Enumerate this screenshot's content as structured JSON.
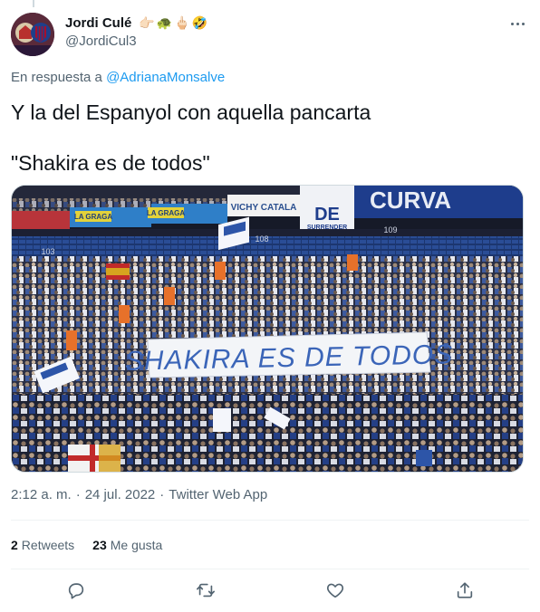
{
  "tweet": {
    "author": {
      "display_name": "Jordi Culé",
      "handle": "@JordiCul3",
      "name_emojis": [
        "👉🏻",
        "🐢",
        "🖕🏻",
        "🤣"
      ]
    },
    "reply_prefix": "En respuesta a",
    "reply_to": "@AdrianaMonsalve",
    "text_line1": "Y la del Espanyol con aquella pancarta",
    "text_line2": "\"Shakira es de todos\"",
    "photo": {
      "banner_text": "SHAKIRA ES DE TODOS",
      "stand_signs": [
        "VICHY CATALA",
        "LA GRAGA",
        "LA GRAGA",
        "CURVA",
        "DE",
        "SURRENDER",
        "108",
        "109",
        "103"
      ]
    },
    "time": "2:12 a. m.",
    "date": "24 jul. 2022",
    "source": "Twitter Web App",
    "separator": "·",
    "stats": {
      "retweets_count": "2",
      "retweets_label": "Retweets",
      "likes_count": "23",
      "likes_label": "Me gusta"
    }
  },
  "icons": {
    "more": "more-dots-icon",
    "reply": "reply-bubble-icon",
    "retweet": "retweet-icon",
    "like": "heart-icon",
    "share": "share-upload-icon"
  },
  "colors": {
    "link": "#1d9bf0",
    "secondary_text": "#536471",
    "primary_text": "#0f1419",
    "border": "#eff3f4"
  }
}
